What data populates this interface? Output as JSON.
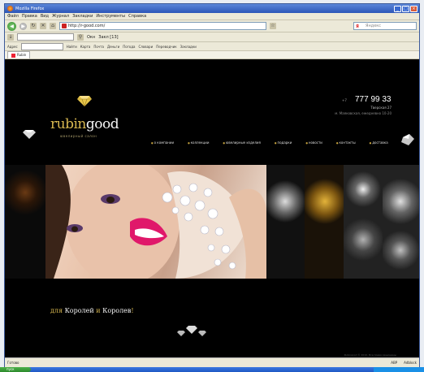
{
  "window": {
    "title": "Mozilla Firefox"
  },
  "menu": [
    "Файл",
    "Правка",
    "Вид",
    "Журнал",
    "Закладки",
    "Инструменты",
    "Справка"
  ],
  "navbar": {
    "url": "http://r-good.com/",
    "search_placeholder": "Яндекс"
  },
  "toolbar3": {
    "field": "",
    "links": [
      "Окн",
      "Закл [13]"
    ]
  },
  "toolbar4": {
    "label": "Адрес",
    "items": [
      "Найти",
      "Карта",
      "Почта",
      "Деньги",
      "Погода",
      "Словари",
      "Переводчик",
      "Закладки"
    ]
  },
  "tab": {
    "label": "Rubin"
  },
  "site": {
    "logo_part1": "rubin",
    "logo_part2": "good",
    "tagline": "ювелирный салон",
    "phone_prefix": "+7",
    "phone": "777 99 33",
    "address1": "Тверская 27",
    "address2": "м. Маяковская, ежедневно 10-20",
    "nav": [
      "о компании",
      "коллекции",
      "ювелирные изделия",
      "подарки",
      "новости",
      "контакты",
      "доставка"
    ],
    "slogan_part1": "для ",
    "slogan_part2": "Королей",
    "slogan_part3": " и ",
    "slogan_part4": "Королев",
    "slogan_part5": "!",
    "copyright": "Rubingood © 2010. Все права защищены"
  },
  "status": {
    "left": "Готово",
    "right": [
      "ABP",
      "Adblock"
    ]
  },
  "taskbar": {
    "start": "пуск"
  },
  "colors": {
    "gold": "#d8b850",
    "page_bg": "#000000",
    "chrome_bg": "#ece9d8"
  }
}
